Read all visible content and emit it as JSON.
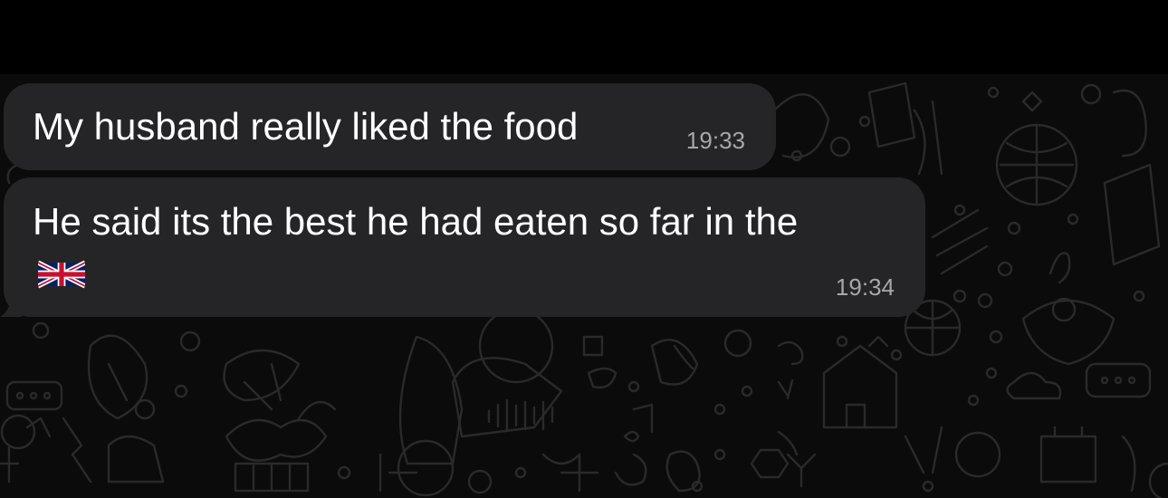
{
  "messages": [
    {
      "text": "My husband really liked the food",
      "time": "19:33",
      "direction": "incoming"
    },
    {
      "text": "He said its the best he had eaten so far in the",
      "time": "19:34",
      "direction": "incoming",
      "emoji": "flag-united-kingdom-icon"
    }
  ],
  "colors": {
    "background": "#0b0b0b",
    "top_bar": "#000000",
    "bubble": "#252528",
    "message_text": "#ffffff",
    "timestamp": "#a7a7ab",
    "wallpaper_doodle": "#2a2a2a"
  }
}
